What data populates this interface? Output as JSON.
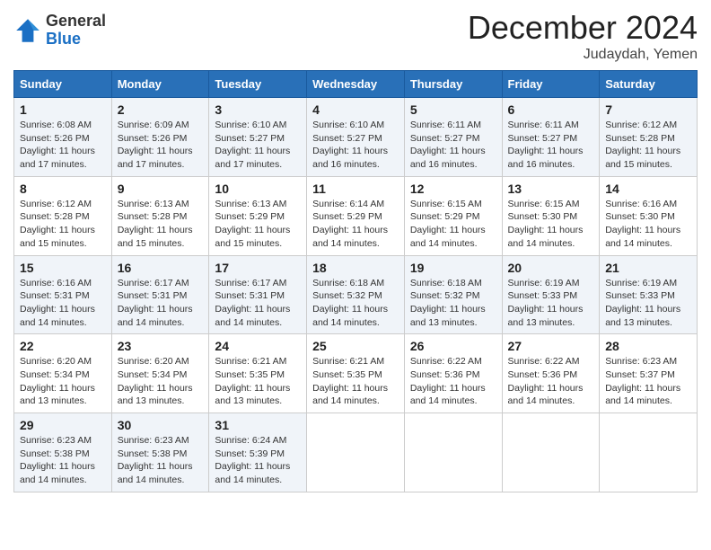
{
  "header": {
    "logo": {
      "general": "General",
      "blue": "Blue"
    },
    "title": "December 2024",
    "location": "Judaydah, Yemen"
  },
  "calendar": {
    "days_of_week": [
      "Sunday",
      "Monday",
      "Tuesday",
      "Wednesday",
      "Thursday",
      "Friday",
      "Saturday"
    ],
    "weeks": [
      [
        {
          "day": "1",
          "sunrise": "6:08 AM",
          "sunset": "5:26 PM",
          "daylight": "11 hours and 17 minutes."
        },
        {
          "day": "2",
          "sunrise": "6:09 AM",
          "sunset": "5:26 PM",
          "daylight": "11 hours and 17 minutes."
        },
        {
          "day": "3",
          "sunrise": "6:10 AM",
          "sunset": "5:27 PM",
          "daylight": "11 hours and 17 minutes."
        },
        {
          "day": "4",
          "sunrise": "6:10 AM",
          "sunset": "5:27 PM",
          "daylight": "11 hours and 16 minutes."
        },
        {
          "day": "5",
          "sunrise": "6:11 AM",
          "sunset": "5:27 PM",
          "daylight": "11 hours and 16 minutes."
        },
        {
          "day": "6",
          "sunrise": "6:11 AM",
          "sunset": "5:27 PM",
          "daylight": "11 hours and 16 minutes."
        },
        {
          "day": "7",
          "sunrise": "6:12 AM",
          "sunset": "5:28 PM",
          "daylight": "11 hours and 15 minutes."
        }
      ],
      [
        {
          "day": "8",
          "sunrise": "6:12 AM",
          "sunset": "5:28 PM",
          "daylight": "11 hours and 15 minutes."
        },
        {
          "day": "9",
          "sunrise": "6:13 AM",
          "sunset": "5:28 PM",
          "daylight": "11 hours and 15 minutes."
        },
        {
          "day": "10",
          "sunrise": "6:13 AM",
          "sunset": "5:29 PM",
          "daylight": "11 hours and 15 minutes."
        },
        {
          "day": "11",
          "sunrise": "6:14 AM",
          "sunset": "5:29 PM",
          "daylight": "11 hours and 14 minutes."
        },
        {
          "day": "12",
          "sunrise": "6:15 AM",
          "sunset": "5:29 PM",
          "daylight": "11 hours and 14 minutes."
        },
        {
          "day": "13",
          "sunrise": "6:15 AM",
          "sunset": "5:30 PM",
          "daylight": "11 hours and 14 minutes."
        },
        {
          "day": "14",
          "sunrise": "6:16 AM",
          "sunset": "5:30 PM",
          "daylight": "11 hours and 14 minutes."
        }
      ],
      [
        {
          "day": "15",
          "sunrise": "6:16 AM",
          "sunset": "5:31 PM",
          "daylight": "11 hours and 14 minutes."
        },
        {
          "day": "16",
          "sunrise": "6:17 AM",
          "sunset": "5:31 PM",
          "daylight": "11 hours and 14 minutes."
        },
        {
          "day": "17",
          "sunrise": "6:17 AM",
          "sunset": "5:31 PM",
          "daylight": "11 hours and 14 minutes."
        },
        {
          "day": "18",
          "sunrise": "6:18 AM",
          "sunset": "5:32 PM",
          "daylight": "11 hours and 14 minutes."
        },
        {
          "day": "19",
          "sunrise": "6:18 AM",
          "sunset": "5:32 PM",
          "daylight": "11 hours and 13 minutes."
        },
        {
          "day": "20",
          "sunrise": "6:19 AM",
          "sunset": "5:33 PM",
          "daylight": "11 hours and 13 minutes."
        },
        {
          "day": "21",
          "sunrise": "6:19 AM",
          "sunset": "5:33 PM",
          "daylight": "11 hours and 13 minutes."
        }
      ],
      [
        {
          "day": "22",
          "sunrise": "6:20 AM",
          "sunset": "5:34 PM",
          "daylight": "11 hours and 13 minutes."
        },
        {
          "day": "23",
          "sunrise": "6:20 AM",
          "sunset": "5:34 PM",
          "daylight": "11 hours and 13 minutes."
        },
        {
          "day": "24",
          "sunrise": "6:21 AM",
          "sunset": "5:35 PM",
          "daylight": "11 hours and 13 minutes."
        },
        {
          "day": "25",
          "sunrise": "6:21 AM",
          "sunset": "5:35 PM",
          "daylight": "11 hours and 14 minutes."
        },
        {
          "day": "26",
          "sunrise": "6:22 AM",
          "sunset": "5:36 PM",
          "daylight": "11 hours and 14 minutes."
        },
        {
          "day": "27",
          "sunrise": "6:22 AM",
          "sunset": "5:36 PM",
          "daylight": "11 hours and 14 minutes."
        },
        {
          "day": "28",
          "sunrise": "6:23 AM",
          "sunset": "5:37 PM",
          "daylight": "11 hours and 14 minutes."
        }
      ],
      [
        {
          "day": "29",
          "sunrise": "6:23 AM",
          "sunset": "5:38 PM",
          "daylight": "11 hours and 14 minutes."
        },
        {
          "day": "30",
          "sunrise": "6:23 AM",
          "sunset": "5:38 PM",
          "daylight": "11 hours and 14 minutes."
        },
        {
          "day": "31",
          "sunrise": "6:24 AM",
          "sunset": "5:39 PM",
          "daylight": "11 hours and 14 minutes."
        },
        null,
        null,
        null,
        null
      ]
    ]
  }
}
